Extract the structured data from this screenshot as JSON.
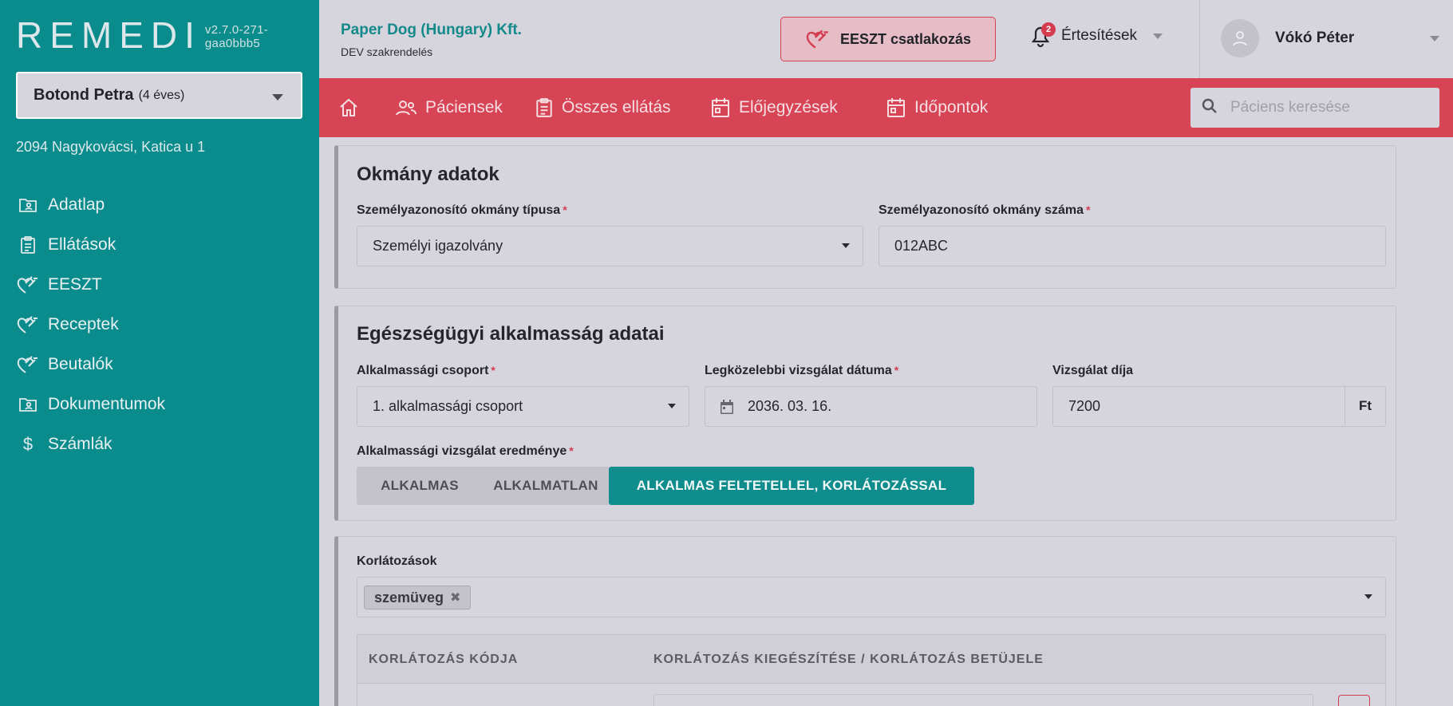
{
  "app": {
    "logo": "REMEDI",
    "version": "v2.7.0-271-gaa0bbb5"
  },
  "patient": {
    "name": "Botond Petra",
    "age": "(4 éves)",
    "address": "2094 Nagykovácsi, Katica u 1"
  },
  "sidebar": {
    "items": [
      {
        "label": "Adatlap",
        "icon": "folder-user-icon"
      },
      {
        "label": "Ellátások",
        "icon": "clipboard-icon"
      },
      {
        "label": "EESZT",
        "icon": "eeszt-heart-icon"
      },
      {
        "label": "Receptek",
        "icon": "eeszt-heart-icon"
      },
      {
        "label": "Beutalók",
        "icon": "eeszt-heart-icon"
      },
      {
        "label": "Dokumentumok",
        "icon": "folder-user-icon"
      },
      {
        "label": "Számlák",
        "icon": "dollar-icon"
      }
    ]
  },
  "header": {
    "org_name": "Paper Dog (Hungary) Kft.",
    "org_sub": "DEV szakrendelés",
    "eeszt_button": "EESZT csatlakozás",
    "notifications_label": "Értesítések",
    "notifications_count": "2",
    "user_name": "Vókó Péter"
  },
  "topnav": {
    "items": [
      {
        "label": "",
        "icon": "home-icon"
      },
      {
        "label": "Páciensek",
        "icon": "users-icon"
      },
      {
        "label": "Összes ellátás",
        "icon": "clipboard-icon"
      },
      {
        "label": "Előjegyzések",
        "icon": "calendar-icon"
      },
      {
        "label": "Időpontok",
        "icon": "calendar-icon"
      }
    ],
    "search_placeholder": "Páciens keresése"
  },
  "document_card": {
    "title": "Okmány adatok",
    "type_label": "Személyazonosító okmány típusa",
    "type_value": "Személyi igazolvány",
    "number_label": "Személyazonosító okmány száma",
    "number_value": "012ABC"
  },
  "health_card": {
    "title": "Egészségügyi alkalmasság adatai",
    "group_label": "Alkalmassági csoport",
    "group_value": "1. alkalmassági csoport",
    "date_label": "Legközelebbi vizsgálat dátuma",
    "date_value": "2036. 03. 16.",
    "fee_label": "Vizsgálat díja",
    "fee_value": "7200",
    "fee_unit": "Ft",
    "result_label": "Alkalmassági vizsgálat eredménye",
    "result_options": [
      "ALKALMAS",
      "ALKALMATLAN",
      "ALKALMAS FELTETELLEL, KORLÁTOZÁSSAL"
    ],
    "result_selected": "ALKALMAS FELTETELLEL, KORLÁTOZÁSSAL"
  },
  "restrictions_card": {
    "label": "Korlátozások",
    "tags": [
      "szemüveg"
    ],
    "columns": [
      "KORLÁTOZÁS KÓDJA",
      "KORLÁTOZÁS KIEGÉSZÍTÉSE / KORLÁTOZÁS BETÜJELE"
    ]
  },
  "colors": {
    "sidebar": "#0b8c8c",
    "topnav": "#d74455",
    "accent": "#0f8c8c",
    "required": "#d43d50"
  }
}
